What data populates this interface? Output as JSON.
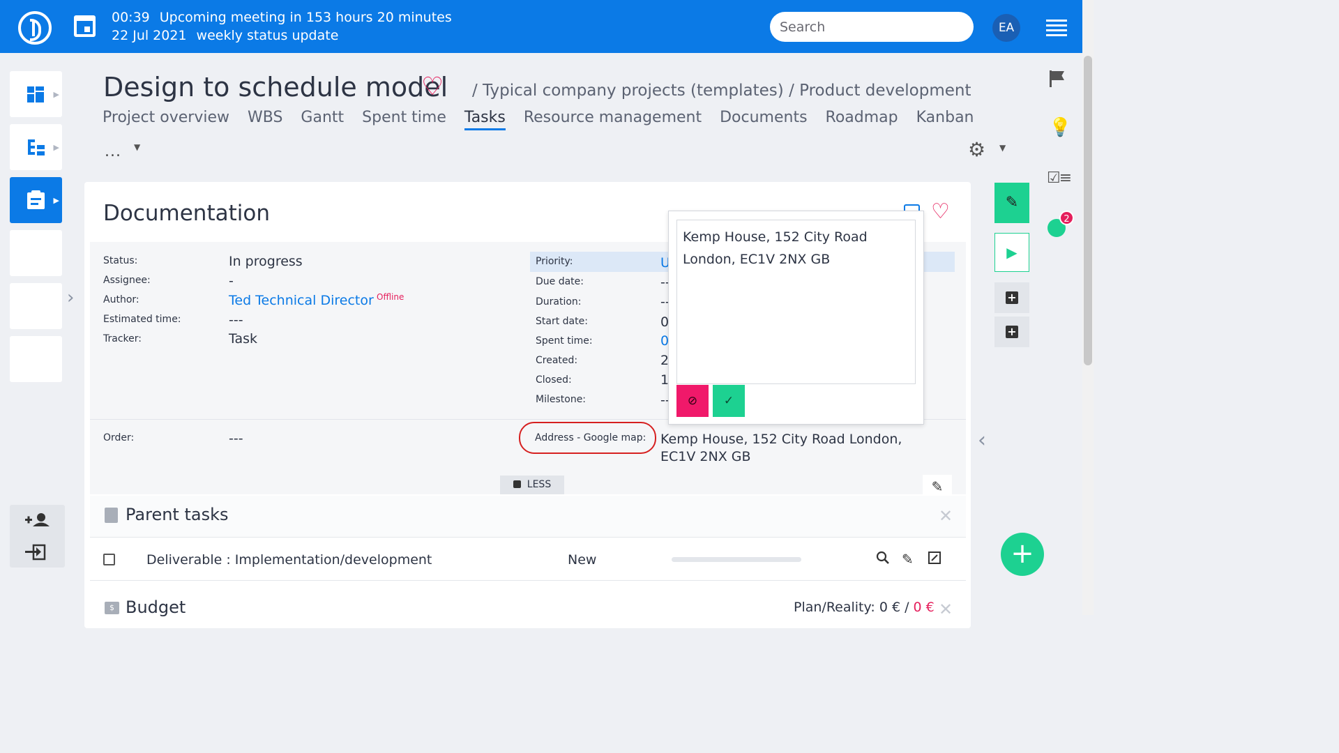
{
  "topbar": {
    "meeting_time": "00:39",
    "meeting_text": "Upcoming meeting in 153 hours 20 minutes",
    "meeting_date": "22 Jul 2021",
    "meeting_title": "weekly status update",
    "search_placeholder": "Search",
    "avatar_initials": "EA"
  },
  "project": {
    "title": "Design to schedule model",
    "breadcrumb": "/ Typical company projects (templates) / Product development"
  },
  "tabs": [
    {
      "label": "Project overview"
    },
    {
      "label": "WBS"
    },
    {
      "label": "Gantt"
    },
    {
      "label": "Spent time"
    },
    {
      "label": "Tasks",
      "active": true
    },
    {
      "label": "Resource management"
    },
    {
      "label": "Documents"
    },
    {
      "label": "Roadmap"
    },
    {
      "label": "Kanban"
    }
  ],
  "more_label": "...",
  "task": {
    "title": "Documentation",
    "left_attrs": [
      {
        "label": "Status:",
        "value": "In progress"
      },
      {
        "label": "Assignee:",
        "value": "-"
      },
      {
        "label": "Author:",
        "value": "Ted Technical Director"
      },
      {
        "label": "Estimated time:",
        "value": "---"
      },
      {
        "label": "Tracker:",
        "value": "Task"
      }
    ],
    "author_status": "Offline",
    "right_attrs": [
      {
        "label": "Priority:",
        "value": "U"
      },
      {
        "label": "Due date:",
        "value": "--"
      },
      {
        "label": "Duration:",
        "value": "--"
      },
      {
        "label": "Start date:",
        "value": "0"
      },
      {
        "label": "Spent time:",
        "value": "0"
      },
      {
        "label": "Created:",
        "value": "2"
      },
      {
        "label": "Closed:",
        "value": "1"
      },
      {
        "label": "Milestone:",
        "value": "--"
      }
    ],
    "order_label": "Order:",
    "order_value": "---",
    "address_label": "Address - Google map:",
    "address_value": "Kemp House, 152 City Road London, EC1V 2NX GB",
    "less_label": "LESS"
  },
  "popup": {
    "text": "Kemp House, 152 City Road\nLondon, EC1V 2NX GB",
    "cancel_symbol": "⊘",
    "confirm_symbol": "✓"
  },
  "parent_tasks": {
    "title": "Parent tasks",
    "rows": [
      {
        "name": "Deliverable : Implementation/development",
        "status": "New",
        "progress": 0
      }
    ]
  },
  "budget": {
    "title": "Budget",
    "plan_label": "Plan/Reality: 0 € /",
    "reality_value": "0 €"
  },
  "right_badge_count": "2",
  "colors": {
    "primary": "#0b7ae6",
    "accent_green": "#1dd191",
    "accent_pink": "#e51f5c"
  },
  "icons": [
    "logo-icon",
    "calendar-icon",
    "menu-icon",
    "heart-icon",
    "gear-icon",
    "flag-icon",
    "bulb-icon",
    "checklist-icon",
    "timer-icon",
    "pencil-icon",
    "play-icon",
    "plus-icon",
    "search-icon",
    "edit-icon"
  ]
}
